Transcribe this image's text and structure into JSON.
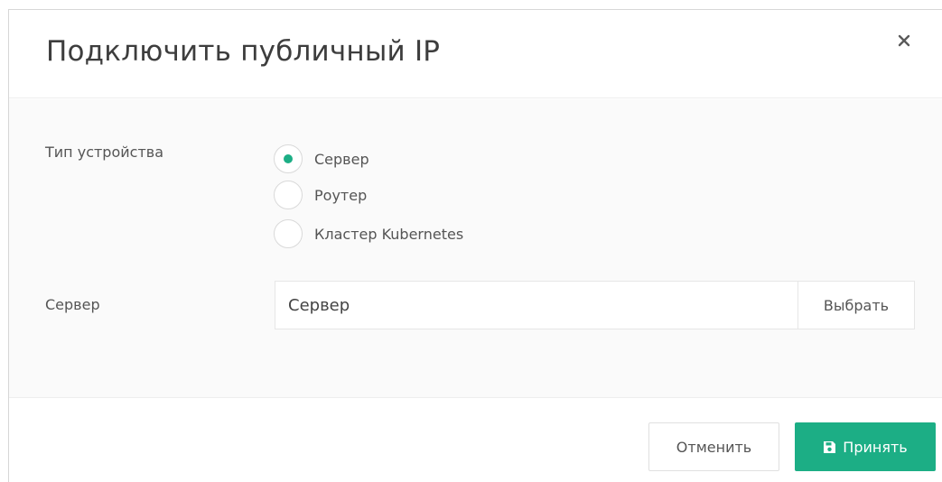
{
  "dialog": {
    "title": "Подключить публичный IP",
    "close_icon": "close-icon"
  },
  "device_type": {
    "label": "Тип устройства",
    "options": [
      {
        "label": "Сервер",
        "selected": true
      },
      {
        "label": "Роутер",
        "selected": false
      },
      {
        "label": "Кластер Kubernetes",
        "selected": false
      }
    ]
  },
  "server": {
    "label": "Сервер",
    "value": "Сервер",
    "select_label": "Выбрать"
  },
  "footer": {
    "cancel_label": "Отменить",
    "accept_label": "Принять",
    "accept_icon": "save-icon"
  },
  "colors": {
    "accent": "#1cae85"
  }
}
